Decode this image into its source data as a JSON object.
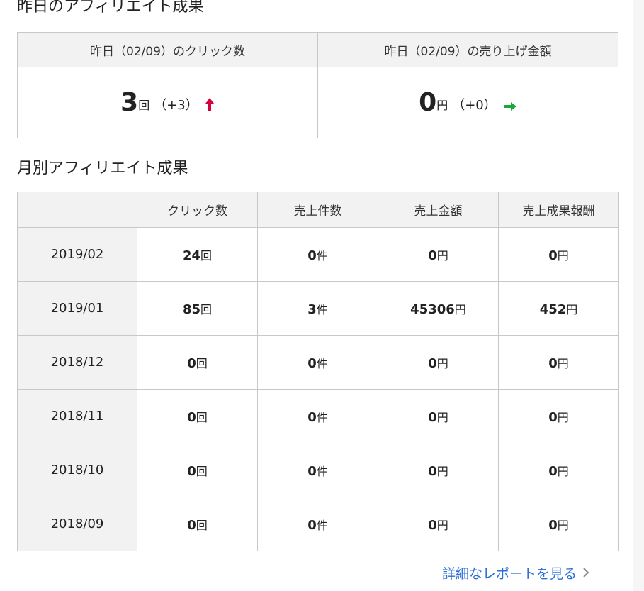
{
  "yesterday": {
    "title": "昨日のアフィリエイト成果",
    "clicks_header": "昨日（02/09）のクリック数",
    "sales_header": "昨日（02/09）の売り上げ金額",
    "clicks_value": "3",
    "clicks_unit": "回",
    "clicks_diff": "（+3）",
    "sales_value": "0",
    "sales_unit": "円",
    "sales_diff": "（+0）",
    "colors": {
      "up_arrow": "#d6003a",
      "flat_arrow": "#1aa83a"
    },
    "icons": {
      "clicks_trend": "arrow-up-icon",
      "sales_trend": "arrow-right-icon"
    }
  },
  "monthly": {
    "title": "月別アフィリエイト成果",
    "headers": [
      "",
      "クリック数",
      "売上件数",
      "売上金額",
      "売上成果報酬"
    ],
    "units": {
      "clicks": "回",
      "count": "件",
      "amount": "円",
      "reward": "円"
    },
    "rows": [
      {
        "month": "2019/02",
        "clicks": "24",
        "count": "0",
        "amount": "0",
        "reward": "0"
      },
      {
        "month": "2019/01",
        "clicks": "85",
        "count": "3",
        "amount": "45306",
        "reward": "452"
      },
      {
        "month": "2018/12",
        "clicks": "0",
        "count": "0",
        "amount": "0",
        "reward": "0"
      },
      {
        "month": "2018/11",
        "clicks": "0",
        "count": "0",
        "amount": "0",
        "reward": "0"
      },
      {
        "month": "2018/10",
        "clicks": "0",
        "count": "0",
        "amount": "0",
        "reward": "0"
      },
      {
        "month": "2018/09",
        "clicks": "0",
        "count": "0",
        "amount": "0",
        "reward": "0"
      }
    ]
  },
  "link": {
    "detail_report": "詳細なレポートを見る",
    "icon": "chevron-right-icon"
  }
}
